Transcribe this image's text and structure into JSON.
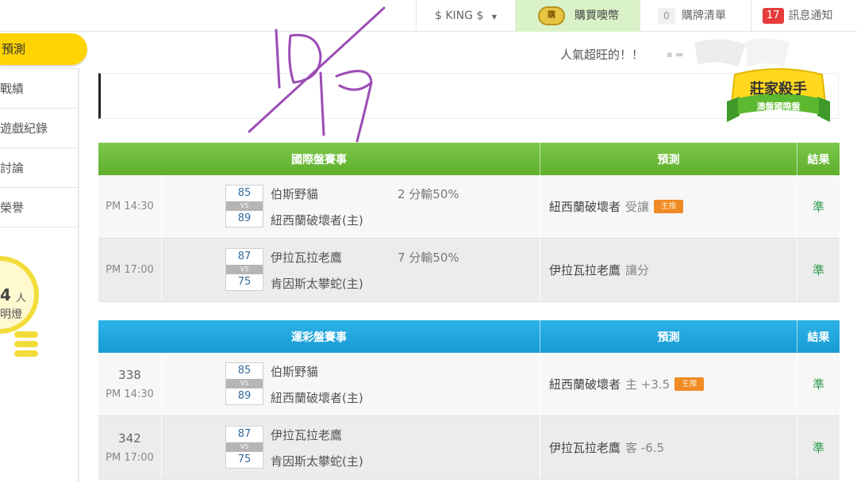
{
  "topbar": {
    "user": "$ KING $",
    "user_arrow": "▼",
    "buy_coin_label": "購買噢幣",
    "coin_icon_text": "購",
    "cart_count": "0",
    "cart_label": "購牌清單",
    "msg_count": "17",
    "msg_label": "訊息通知"
  },
  "sidebar": {
    "active_item": "預測",
    "items": [
      "戰績",
      "遊戲紀錄",
      "討論",
      "榮譽"
    ],
    "lamp_count": "4",
    "lamp_unit": "人",
    "lamp_label": "明燈"
  },
  "banner": {
    "tagline": "人氣超旺的！！",
    "tagline_dash": "▪ ▬",
    "badge_title": "莊家殺手",
    "badge_subtitle": "澳盤國際盤"
  },
  "international": {
    "headers": {
      "game": "國際盤賽事",
      "prediction": "預測",
      "result": "結果"
    },
    "rows": [
      {
        "time": "PM 14:30",
        "score1": "85",
        "score2": "89",
        "vs": "VS",
        "team1": "伯斯野貓",
        "team2": "紐西蘭破壞者(主)",
        "margin": "2 分輸50%",
        "pred_team": "紐西蘭破壞者",
        "pred_note": "受讓",
        "pred_tag": "主推",
        "result": "準"
      },
      {
        "time": "PM 17:00",
        "score1": "87",
        "score2": "75",
        "vs": "VS",
        "team1": "伊拉瓦拉老鷹",
        "team2": "肯因斯太攀蛇(主)",
        "margin": "7 分輸50%",
        "pred_team": "伊拉瓦拉老鷹",
        "pred_note": "讓分",
        "pred_tag": "",
        "result": "準"
      }
    ]
  },
  "sports_lottery": {
    "headers": {
      "game": "運彩盤賽事",
      "prediction": "預測",
      "result": "結果"
    },
    "rows": [
      {
        "num": "338",
        "time": "PM 14:30",
        "score1": "85",
        "score2": "89",
        "vs": "VS",
        "team1": "伯斯野貓",
        "team2": "紐西蘭破壞者(主)",
        "pred_team": "紐西蘭破壞者",
        "pred_note": "主 +3.5",
        "pred_tag": "主推",
        "result": "準"
      },
      {
        "num": "342",
        "time": "PM 17:00",
        "score1": "87",
        "score2": "75",
        "vs": "VS",
        "team1": "伊拉瓦拉老鷹",
        "team2": "肯因斯太攀蛇(主)",
        "pred_team": "伊拉瓦拉老鷹",
        "pred_note": "客 -6.5",
        "pred_tag": "",
        "result": "準"
      }
    ]
  },
  "colors": {
    "green_header": "#6cbb3c",
    "blue_header": "#1ea5dc",
    "result": "#2d9a4c",
    "tag": "#f08a24",
    "active": "#ffd400"
  },
  "annotation": {
    "handwritten": "10/19"
  }
}
